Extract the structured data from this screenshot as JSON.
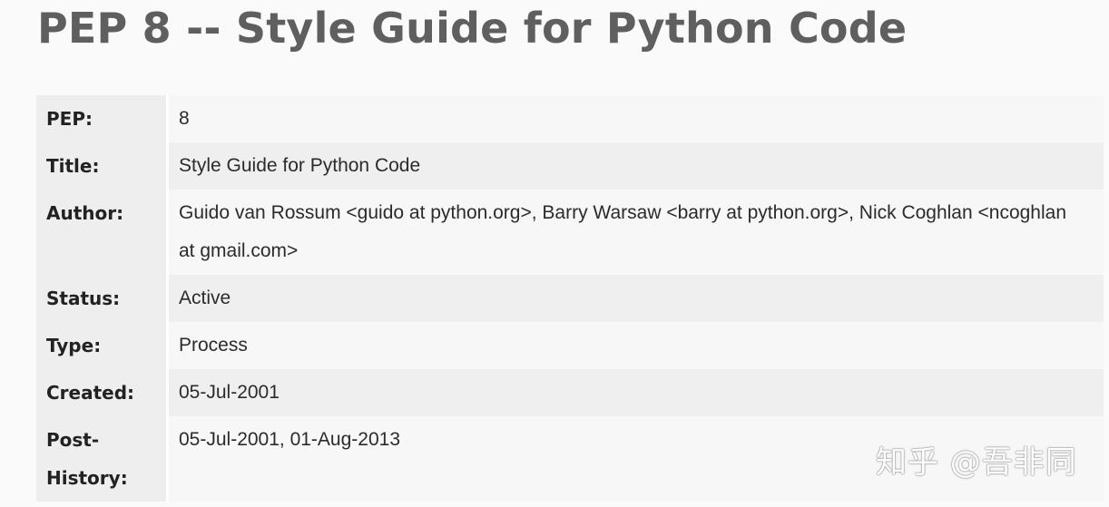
{
  "page": {
    "title": "PEP 8 -- Style Guide for Python Code"
  },
  "header": {
    "rows": [
      {
        "field": "PEP:",
        "value": "8"
      },
      {
        "field": "Title:",
        "value": "Style Guide for Python Code"
      },
      {
        "field": "Author:",
        "value": "Guido van Rossum <guido at python.org>, Barry Warsaw <barry at python.org>, Nick Coghlan <ncoghlan at gmail.com>"
      },
      {
        "field": "Status:",
        "value": "Active"
      },
      {
        "field": "Type:",
        "value": "Process"
      },
      {
        "field": "Created:",
        "value": "05-Jul-2001"
      },
      {
        "field": "Post-History:",
        "value": "05-Jul-2001, 01-Aug-2013"
      }
    ]
  },
  "watermark": {
    "text": "知乎 @吾非同"
  }
}
